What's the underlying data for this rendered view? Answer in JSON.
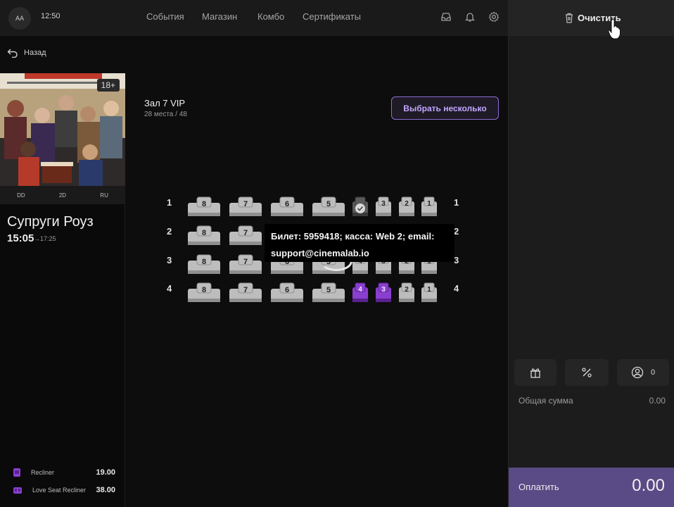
{
  "topbar": {
    "avatar": "AA",
    "time": "12:50",
    "nav": [
      "События",
      "Магазин",
      "Комбо",
      "Сертификаты"
    ]
  },
  "back": "Назад",
  "movie": {
    "age": "18+",
    "formats": [
      "DD",
      "2D",
      "RU"
    ],
    "title": "Супруги Роуз",
    "time": "15:05",
    "end": "→17:25"
  },
  "hall": {
    "name": "Зал 7 VIP",
    "seats": "28 места / 48",
    "select_button": "Выбрать несколько"
  },
  "seatmap": {
    "rows": [
      "1",
      "2",
      "3",
      "4"
    ],
    "big_seats": [
      "8",
      "7",
      "6",
      "5"
    ],
    "small_seats": [
      "4",
      "3",
      "2",
      "1"
    ],
    "accent": "#8b3fd0"
  },
  "tooltip": {
    "line1": "Билет: 5959418; касса: Web 2; email:",
    "line2": "support@cinemalab.io"
  },
  "legend": [
    {
      "name": "Recliner",
      "price": "19.00"
    },
    {
      "name": "Love Seat Recliner",
      "price": "38.00"
    }
  ],
  "cart": {
    "clear": "Очистить",
    "user_count": "0",
    "total_label": "Общая сумма",
    "total_value": "0.00",
    "pay_label": "Оплатить",
    "pay_amount": "0.00"
  }
}
